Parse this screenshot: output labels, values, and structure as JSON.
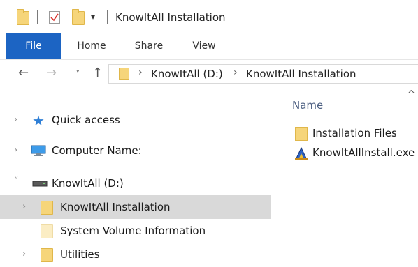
{
  "window": {
    "title": "KnowItAll Installation",
    "qa_dropdown": "▾"
  },
  "ribbon": {
    "tabs": [
      "File",
      "Home",
      "Share",
      "View"
    ]
  },
  "address": {
    "back": "←",
    "forward": "→",
    "recent": "˅",
    "up": "↑",
    "separator": "›",
    "crumbs": [
      "KnowItAll (D:)",
      "KnowItAll Installation"
    ]
  },
  "nav": {
    "chevron_collapsed": "›",
    "chevron_expanded": "˅",
    "items": [
      {
        "label": "Quick access",
        "icon": "star-icon"
      },
      {
        "label": "Computer Name:",
        "icon": "monitor-icon"
      },
      {
        "label": "KnowItAll (D:)",
        "icon": "drive-icon"
      },
      {
        "label": "KnowItAll Installation",
        "icon": "folder-icon",
        "selected": true
      },
      {
        "label": "System Volume Information",
        "icon": "folder-icon"
      },
      {
        "label": "Utilities",
        "icon": "folder-icon"
      }
    ]
  },
  "content": {
    "column_header": "Name",
    "sort_caret": "^",
    "files": [
      {
        "name": "Installation Files",
        "icon": "folder-icon"
      },
      {
        "name": "KnowItAllInstall.exe",
        "icon": "installer-icon"
      }
    ]
  }
}
